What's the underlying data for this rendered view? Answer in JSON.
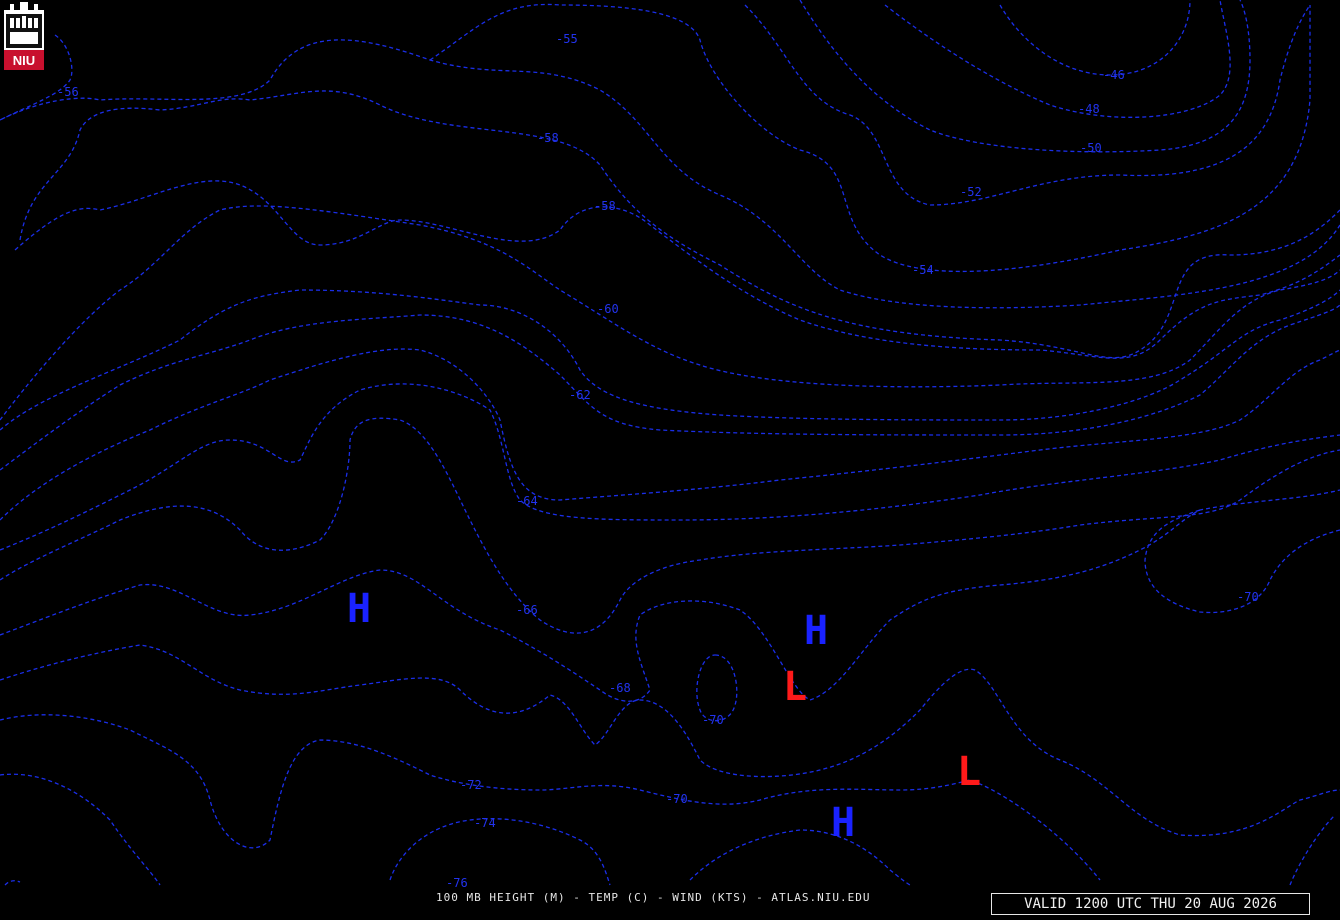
{
  "caption": "100 MB HEIGHT (M) - TEMP (C) - WIND (KTS) - ATLAS.NIU.EDU",
  "valid_time": "VALID 1200 UTC THU 20 AUG 2026",
  "logo_text": "NIU",
  "colors": {
    "isotherm": "#1a2ee8",
    "high": "#1a22ff",
    "low": "#ff1a1a",
    "background": "#000000",
    "text": "#e6e6e6"
  },
  "isotherm_labels": [
    "-46",
    "-48",
    "-50",
    "-52",
    "-54",
    "-55",
    "-56",
    "-58",
    "-58",
    "-60",
    "-62",
    "-64",
    "-66",
    "-68",
    "-70",
    "-70",
    "-70",
    "-72",
    "-74",
    "-76"
  ],
  "pressure_centers": [
    {
      "type": "high",
      "label": "H"
    },
    {
      "type": "high",
      "label": "H"
    },
    {
      "type": "high",
      "label": "H"
    },
    {
      "type": "low",
      "label": "L"
    },
    {
      "type": "low",
      "label": "L"
    }
  ]
}
